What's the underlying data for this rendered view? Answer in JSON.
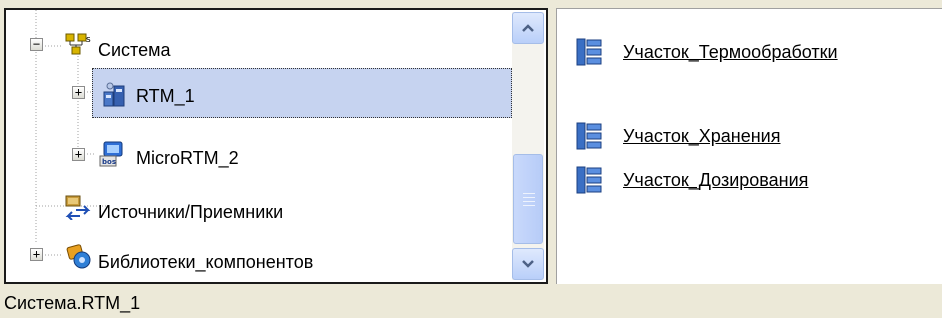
{
  "tree": {
    "nodes": [
      {
        "label": "Система",
        "expander": "−",
        "icon": "network-icon"
      },
      {
        "label": "RTM_1",
        "expander": "+",
        "icon": "runtime-module-icon",
        "selected": true
      },
      {
        "label": "MicroRTM_2",
        "expander": "+",
        "icon": "os-computer-icon"
      },
      {
        "label": "Источники/Приемники",
        "expander": "",
        "icon": "sources-receivers-icon"
      },
      {
        "label": "Библиотеки_компонентов",
        "expander": "+",
        "icon": "component-library-icon"
      }
    ],
    "scrollbar": {
      "position": 0.55,
      "visible_fraction": 0.32
    }
  },
  "sections": [
    {
      "label": "Участок_Термообработки",
      "icon": "section-list-icon"
    },
    {
      "label": "Участок_Хранения",
      "icon": "section-list-icon"
    },
    {
      "label": "Участок_Дозирования",
      "icon": "section-list-icon"
    }
  ],
  "status": {
    "text": "Система.RTM_1"
  },
  "colors": {
    "window_bg": "#ece9d8",
    "selection": "#c6d3f0",
    "scrollbar": "#b9cff9"
  }
}
